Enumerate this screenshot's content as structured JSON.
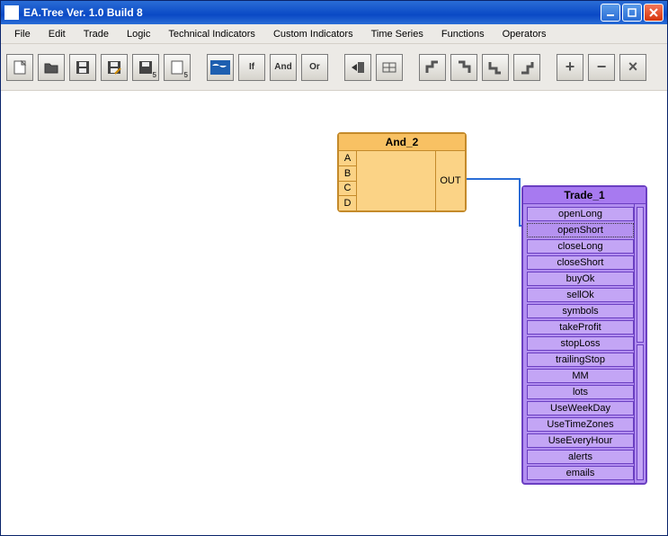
{
  "window": {
    "title": "EA.Tree Ver. 1.0 Build 8"
  },
  "menu": {
    "items": [
      "File",
      "Edit",
      "Trade",
      "Logic",
      "Technical Indicators",
      "Custom Indicators",
      "Time Series",
      "Functions",
      "Operators"
    ]
  },
  "toolbar": {
    "buttons": [
      {
        "name": "new-icon",
        "glyph": ""
      },
      {
        "name": "open-icon",
        "glyph": ""
      },
      {
        "name": "save-icon",
        "glyph": ""
      },
      {
        "name": "save-edit-icon",
        "glyph": ""
      },
      {
        "name": "export5a-icon",
        "glyph": "5"
      },
      {
        "name": "export5b-icon",
        "glyph": "5"
      },
      {
        "name": "world-icon",
        "glyph": ""
      },
      {
        "name": "if-icon",
        "glyph": "If"
      },
      {
        "name": "and-icon",
        "glyph": "And"
      },
      {
        "name": "or-icon",
        "glyph": "Or"
      },
      {
        "name": "arrow-in-icon",
        "glyph": ""
      },
      {
        "name": "panel-icon",
        "glyph": ""
      },
      {
        "name": "step-a-icon",
        "glyph": ""
      },
      {
        "name": "step-b-icon",
        "glyph": ""
      },
      {
        "name": "step-c-icon",
        "glyph": ""
      },
      {
        "name": "step-d-icon",
        "glyph": ""
      },
      {
        "name": "plus-icon",
        "glyph": "+"
      },
      {
        "name": "minus-icon",
        "glyph": "−"
      },
      {
        "name": "close-action-icon",
        "glyph": "×"
      }
    ]
  },
  "nodes": {
    "and": {
      "title": "And_2",
      "inputs": [
        "A",
        "B",
        "C",
        "D"
      ],
      "out": "OUT"
    },
    "trade": {
      "title": "Trade_1",
      "ports": [
        "openLong",
        "openShort",
        "closeLong",
        "closeShort",
        "buyOk",
        "sellOk",
        "symbols",
        "takeProfit",
        "stopLoss",
        "trailingStop",
        "MM",
        "lots",
        "UseWeekDay",
        "UseTimeZones",
        "UseEveryHour",
        "alerts",
        "emails"
      ],
      "selectedIndex": 1
    }
  }
}
